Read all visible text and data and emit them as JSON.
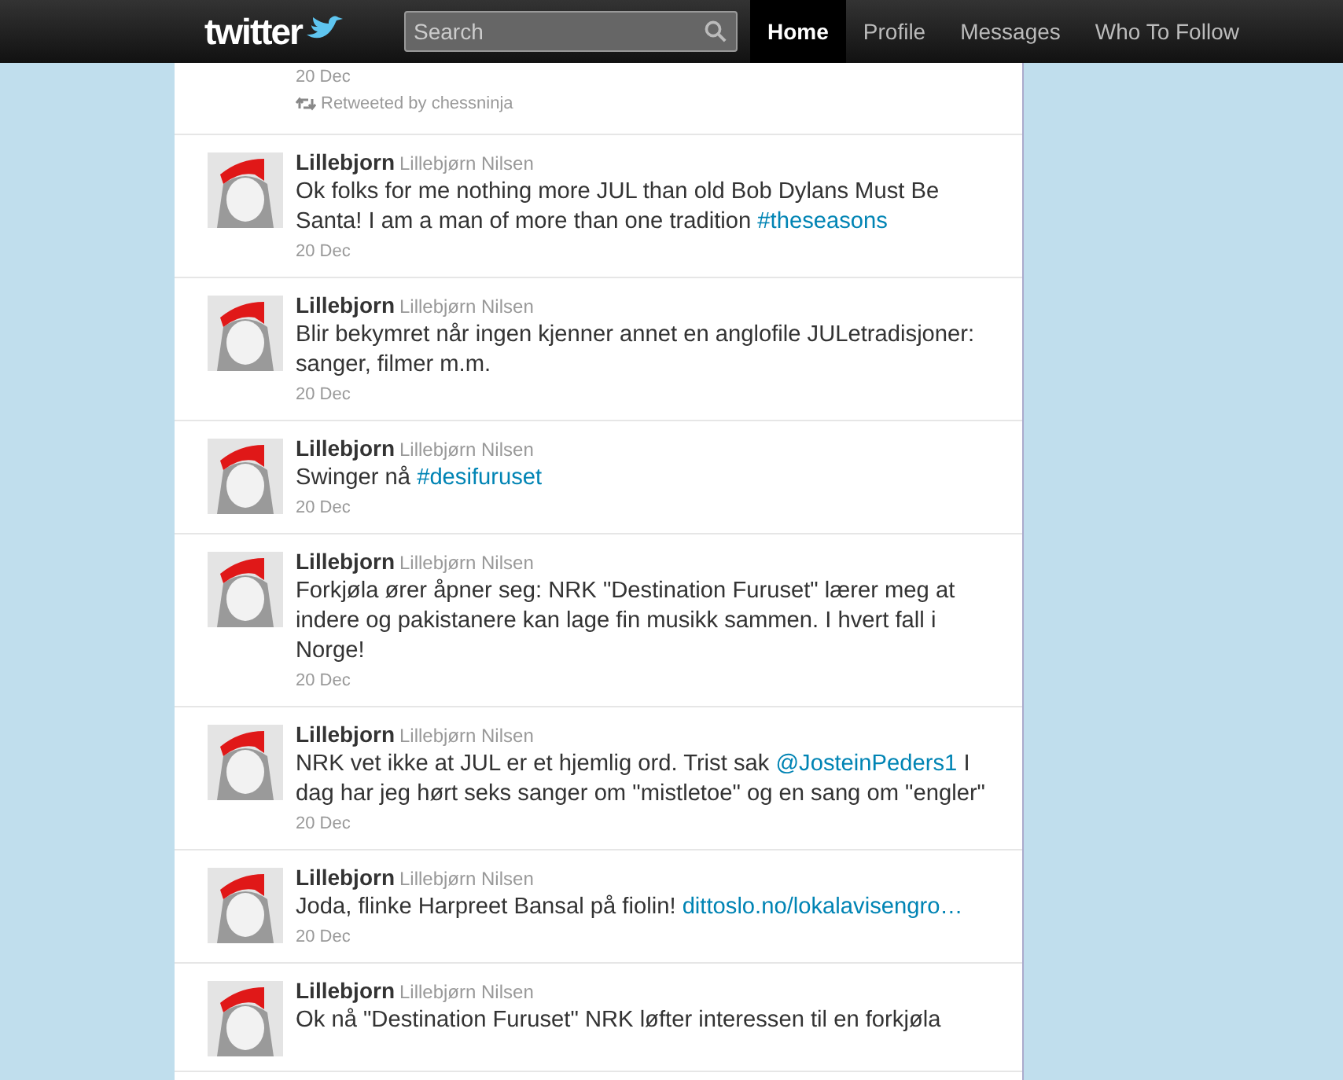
{
  "topbar": {
    "logo": "twitter",
    "search": {
      "placeholder": "Search"
    },
    "nav": [
      {
        "label": "Home",
        "selected": true
      },
      {
        "label": "Profile",
        "selected": false
      },
      {
        "label": "Messages",
        "selected": false
      },
      {
        "label": "Who To Follow",
        "selected": false
      }
    ]
  },
  "partial_tweet": {
    "date": "20 Dec",
    "retweet": "Retweeted by chessninja"
  },
  "tweets": [
    {
      "username": "Lillebjorn",
      "fullname": "Lillebjørn Nilsen",
      "text": [
        {
          "kind": "plain",
          "text": "Ok folks for me nothing more JUL than old Bob Dylans Must Be Santa! I am a man of more than one tradition "
        },
        {
          "kind": "link",
          "text": "#theseasons"
        }
      ],
      "date": "20 Dec"
    },
    {
      "username": "Lillebjorn",
      "fullname": "Lillebjørn Nilsen",
      "text": [
        {
          "kind": "plain",
          "text": "Blir bekymret når ingen kjenner annet en anglofile JULetradisjoner: sanger, filmer m.m."
        }
      ],
      "date": "20 Dec"
    },
    {
      "username": "Lillebjorn",
      "fullname": "Lillebjørn Nilsen",
      "text": [
        {
          "kind": "plain",
          "text": "Swinger nå "
        },
        {
          "kind": "link",
          "text": "#desifuruset"
        }
      ],
      "date": "20 Dec"
    },
    {
      "username": "Lillebjorn",
      "fullname": "Lillebjørn Nilsen",
      "text": [
        {
          "kind": "plain",
          "text": "Forkjøla ører åpner seg: NRK \"Destination Furuset\" lærer meg at indere og pakistanere kan lage fin musikk sammen. I hvert fall i Norge!"
        }
      ],
      "date": "20 Dec"
    },
    {
      "username": "Lillebjorn",
      "fullname": "Lillebjørn Nilsen",
      "text": [
        {
          "kind": "plain",
          "text": "NRK vet ikke at JUL er et hjemlig ord. Trist sak "
        },
        {
          "kind": "link",
          "text": "@JosteinPeders1"
        },
        {
          "kind": "plain",
          "text": " I dag har jeg hørt seks sanger om \"mistletoe\" og en sang om \"engler\""
        }
      ],
      "date": "20 Dec"
    },
    {
      "username": "Lillebjorn",
      "fullname": "Lillebjørn Nilsen",
      "text": [
        {
          "kind": "plain",
          "text": "Joda, flinke Harpreet Bansal på fiolin! "
        },
        {
          "kind": "link",
          "text": "dittoslo.no/lokalavisengro…"
        }
      ],
      "date": "20 Dec"
    },
    {
      "username": "Lillebjorn",
      "fullname": "Lillebjørn Nilsen",
      "text": [
        {
          "kind": "plain",
          "text": "Ok nå \"Destination Furuset\" NRK løfter interessen til en forkjøla"
        }
      ]
    }
  ]
}
